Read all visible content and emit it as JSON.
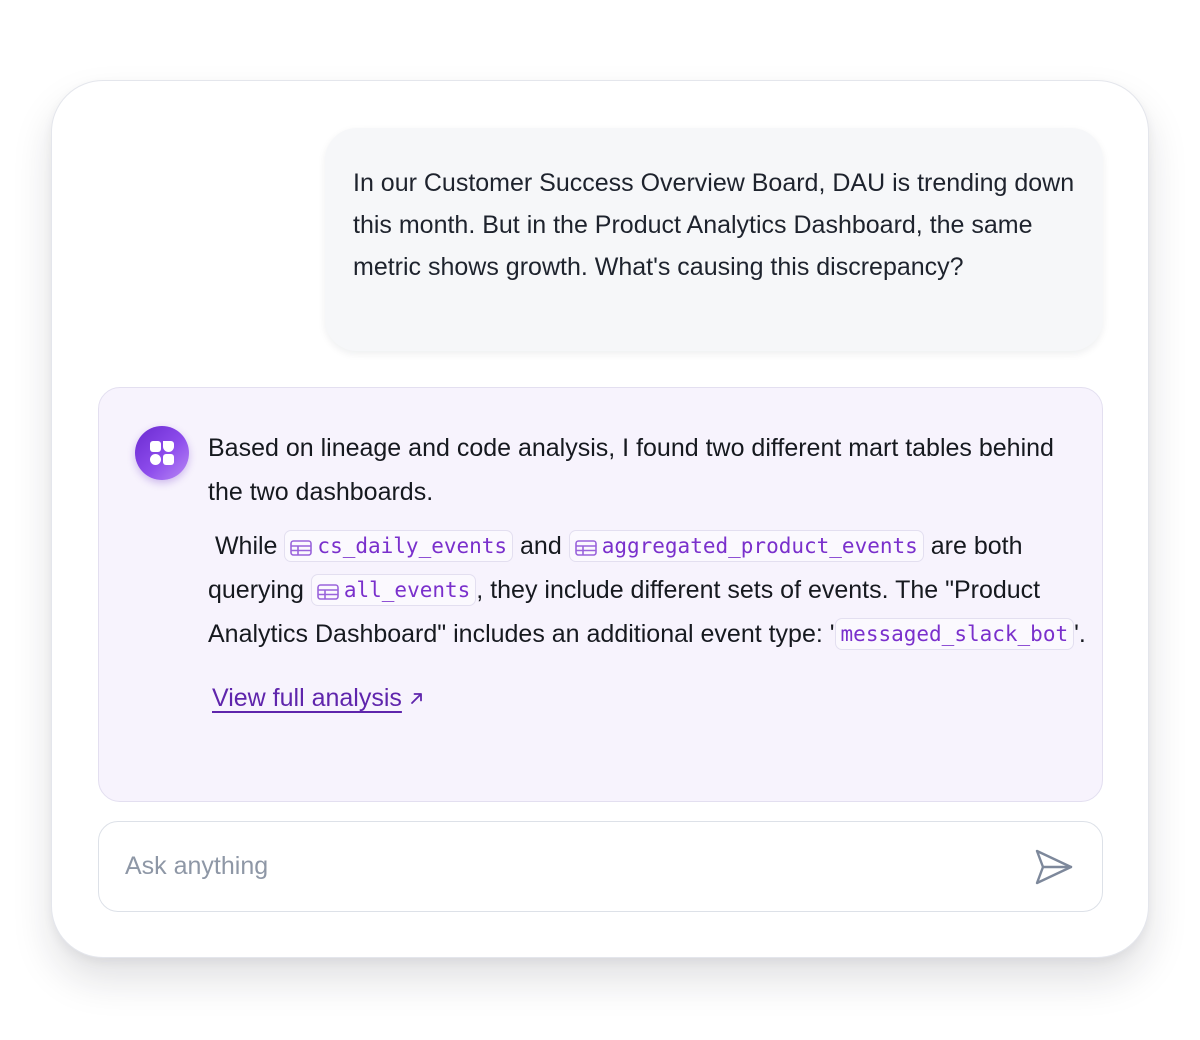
{
  "user_message": {
    "text": "In our Customer Success Overview Board, DAU is trending down this month. But in the Product Analytics Dashboard, the same metric shows growth. What's causing this discrepancy?"
  },
  "assistant_message": {
    "avatar_icon": "assistant-logo-icon",
    "intro": "Based on lineage and code analysis, I found two different mart tables behind the two dashboards.",
    "while_text": "While",
    "table_1": "cs_daily_events",
    "and_text": "and",
    "table_2": "aggregated_product_events",
    "are_text": "are both querying",
    "table_3": "all_events",
    "rest_text": ", they include different sets of events. The \"Product Analytics Dashboard\" includes an additional event type: '",
    "event_type": "messaged_slack_bot",
    "end_text": "'.",
    "table_icon": "table-icon",
    "link_label": "View full analysis",
    "link_icon": "arrow-up-right-icon"
  },
  "composer": {
    "placeholder": "Ask anything",
    "value": "",
    "send_icon": "send-icon"
  },
  "colors": {
    "assistant_bg": "#f7f3fd",
    "accent": "#7a30cc",
    "link": "#5f25ac",
    "user_bubble_bg": "#f6f7f9"
  }
}
